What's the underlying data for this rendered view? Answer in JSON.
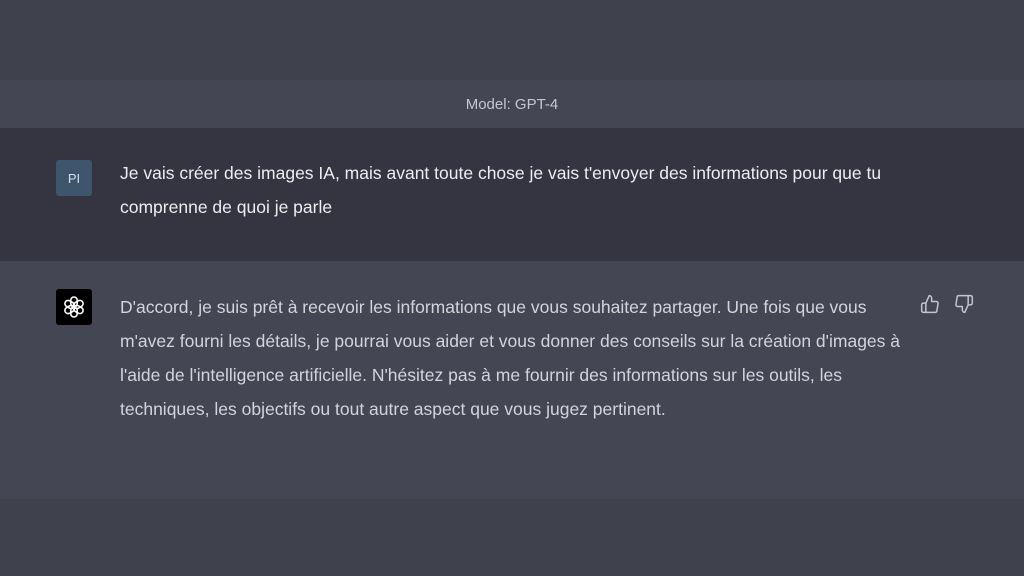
{
  "header": {
    "model_label": "Model: GPT-4"
  },
  "conversation": {
    "user": {
      "avatar_initials": "PI",
      "message": "Je vais créer des images IA, mais avant toute chose je vais t'envoyer des informations pour que tu comprenne de quoi je parle"
    },
    "assistant": {
      "avatar_icon": "openai-logo-icon",
      "message": "D'accord, je suis prêt à recevoir les informations que vous souhaitez partager. Une fois que vous m'avez fourni les détails, je pourrai vous aider et vous donner des conseils sur la création d'images à l'aide de l'intelligence artificielle. N'hésitez pas à me fournir des informations sur les outils, les techniques, les objectifs ou tout autre aspect que vous jugez pertinent."
    },
    "feedback_icons": [
      "thumbs-up-icon",
      "thumbs-down-icon"
    ]
  },
  "colors": {
    "background": "#3f414d",
    "model_bar": "#444654",
    "user_row": "#343541",
    "assistant_row": "#444654",
    "user_avatar": "#3e566b",
    "assistant_avatar": "#000000"
  }
}
